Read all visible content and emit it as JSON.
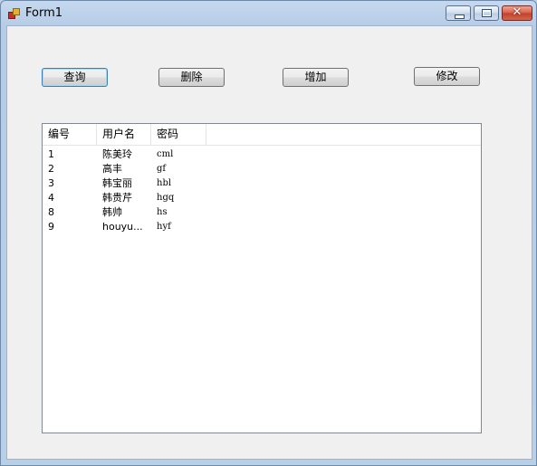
{
  "window": {
    "title": "Form1"
  },
  "toolbar": {
    "query_label": "查询",
    "delete_label": "删除",
    "add_label": "增加",
    "edit_label": "修改"
  },
  "table": {
    "headers": [
      "编号",
      "用户名",
      "密码"
    ],
    "rows": [
      {
        "id": "1",
        "username": "陈美玲",
        "password": "cml"
      },
      {
        "id": "2",
        "username": "高丰",
        "password": "gf"
      },
      {
        "id": "3",
        "username": "韩宝丽",
        "password": "hbl"
      },
      {
        "id": "4",
        "username": "韩贵芹",
        "password": "hgq"
      },
      {
        "id": "8",
        "username": "韩帅",
        "password": "hs"
      },
      {
        "id": "9",
        "username": "houyu...",
        "password": "hyf"
      }
    ]
  },
  "icons": {
    "app": "form-app-icon",
    "minimize": "minimize-icon",
    "maximize": "maximize-icon",
    "close": "close-icon"
  },
  "colors": {
    "titlebar": "#b9cfe8",
    "client_bg": "#f0f0f0",
    "close_button": "#c8503a",
    "focus_border": "#3c7fb1"
  }
}
